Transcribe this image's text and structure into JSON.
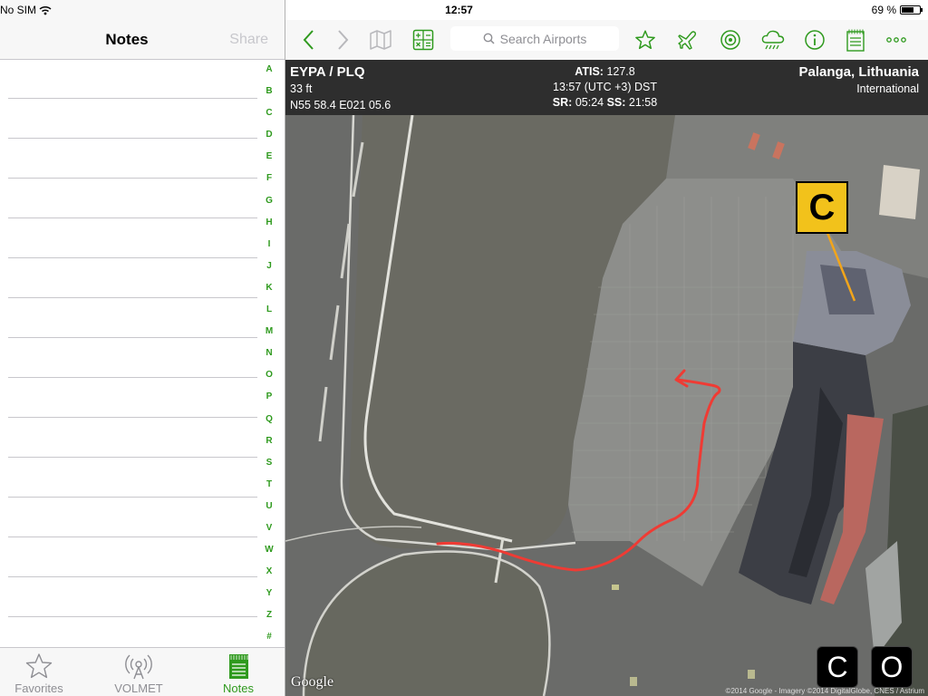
{
  "status": {
    "carrier": "No SIM",
    "time": "12:57",
    "battery_text": "69 %",
    "battery_level": 0.69
  },
  "notes_panel": {
    "title": "Notes",
    "share_label": "Share",
    "index": [
      "A",
      "B",
      "C",
      "D",
      "E",
      "F",
      "G",
      "H",
      "I",
      "J",
      "K",
      "L",
      "M",
      "N",
      "O",
      "P",
      "Q",
      "R",
      "S",
      "T",
      "U",
      "V",
      "W",
      "X",
      "Y",
      "Z",
      "#"
    ]
  },
  "tabs": [
    {
      "label": "Favorites",
      "icon": "star-icon",
      "active": false
    },
    {
      "label": "VOLMET",
      "icon": "antenna-icon",
      "active": false
    },
    {
      "label": "Notes",
      "icon": "notepad-icon",
      "active": true
    }
  ],
  "toolbar": {
    "search_placeholder": "Search Airports",
    "icons": [
      "back-chevron-icon",
      "forward-chevron-icon",
      "map-icon",
      "calculator-icon",
      "star-icon",
      "airplane-icon",
      "target-icon",
      "weather-cloud-icon",
      "info-icon",
      "checklist-icon",
      "more-dots-icon"
    ]
  },
  "airport": {
    "code": "EYPA / PLQ",
    "elevation": "33 ft",
    "coords": "N55 58.4 E021 05.6",
    "atis_label": "ATIS:",
    "atis": "127.8",
    "local_time": "13:57 (UTC +3) DST",
    "sr_label": "SR:",
    "sunrise": "05:24",
    "ss_label": "SS:",
    "sunset": "21:58",
    "city": "Palanga, Lithuania",
    "type": "International"
  },
  "map": {
    "marker_label": "C",
    "google_logo": "Google",
    "credit": "©2014 Google - Imagery ©2014 DigitalGlobe, CNES / Astrium",
    "buttons": [
      "C",
      "O"
    ],
    "colors": {
      "route": "#ee3a33",
      "marker": "#f2c21b",
      "accent": "#2f9a1e"
    }
  }
}
